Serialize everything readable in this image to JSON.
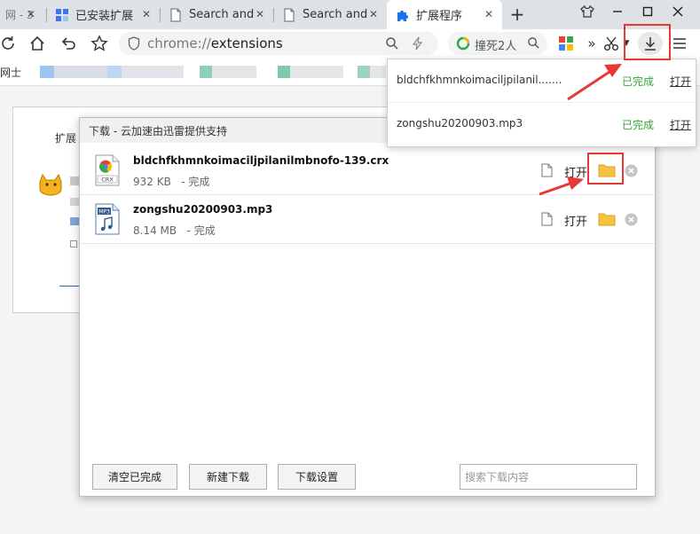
{
  "tabs": [
    {
      "label": "网 - 3",
      "kind": "blank"
    },
    {
      "label": "已安装扩展",
      "kind": "grid"
    },
    {
      "label": "Search and",
      "kind": "page"
    },
    {
      "label": "Search and",
      "kind": "page"
    },
    {
      "label": "扩展程序",
      "kind": "puzzle",
      "active": true
    }
  ],
  "omnibox": {
    "scheme": "chrome://",
    "path": "extensions"
  },
  "search_hint": "撞死2人",
  "bookmarks": {
    "first_label": "网士"
  },
  "page": {
    "card_title": "扩展"
  },
  "dialog": {
    "title": "下载 - 云加速由迅雷提供支持",
    "items": [
      {
        "name": "bldchfkhmnkoimaciljpilanilmbnofo-139.crx",
        "size": "932 KB",
        "status": "- 完成",
        "open": "打开",
        "badge": "CRX"
      },
      {
        "name": "zongshu20200903.mp3",
        "size": "8.14 MB",
        "status": "- 完成",
        "open": "打开",
        "badge": "MP3"
      }
    ],
    "buttons": {
      "clear": "清空已完成",
      "new": "新建下载",
      "settings": "下载设置"
    },
    "search_placeholder": "搜索下载内容"
  },
  "popup": {
    "items": [
      {
        "name": "bldchfkhmnkoimaciljpilanil.......",
        "status": "已完成",
        "open": "打开"
      },
      {
        "name": "zongshu20200903.mp3",
        "status": "已完成",
        "open": "打开"
      }
    ]
  },
  "colors": {
    "accent_red": "#e53935",
    "done_green": "#3aa335",
    "folder_yellow": "#f5c242"
  }
}
